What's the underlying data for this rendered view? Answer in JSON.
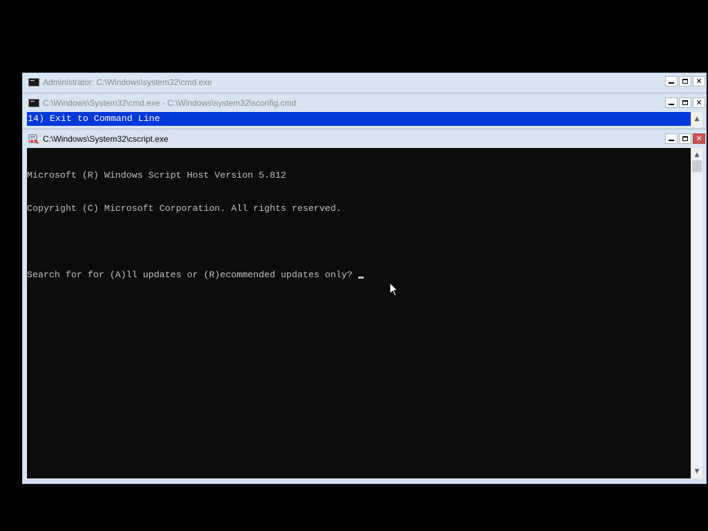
{
  "windows": {
    "admin_cmd": {
      "title": "Administrator: C:\\Windows\\system32\\cmd.exe"
    },
    "sconfig": {
      "title": "C:\\Windows\\System32\\cmd.exe - C:\\Windows\\system32\\sconfig.cmd",
      "highlighted_line": "14) Exit to Command Line"
    },
    "cscript": {
      "title": "C:\\Windows\\System32\\cscript.exe",
      "lines": [
        "Microsoft (R) Windows Script Host Version 5.812",
        "Copyright (C) Microsoft Corporation. All rights reserved.",
        "",
        "Search for for (A)ll updates or (R)ecommended updates only? "
      ]
    }
  },
  "controls": {
    "minimize": "minimize-icon",
    "maximize": "maximize-icon",
    "close": "close-icon"
  },
  "colors": {
    "desktop": "#000000",
    "frame": "#d9e4f1",
    "console_bg": "#0c0c0c",
    "console_fg": "#c0c0c0",
    "selection": "#0037da",
    "close_active": "#c75050"
  }
}
